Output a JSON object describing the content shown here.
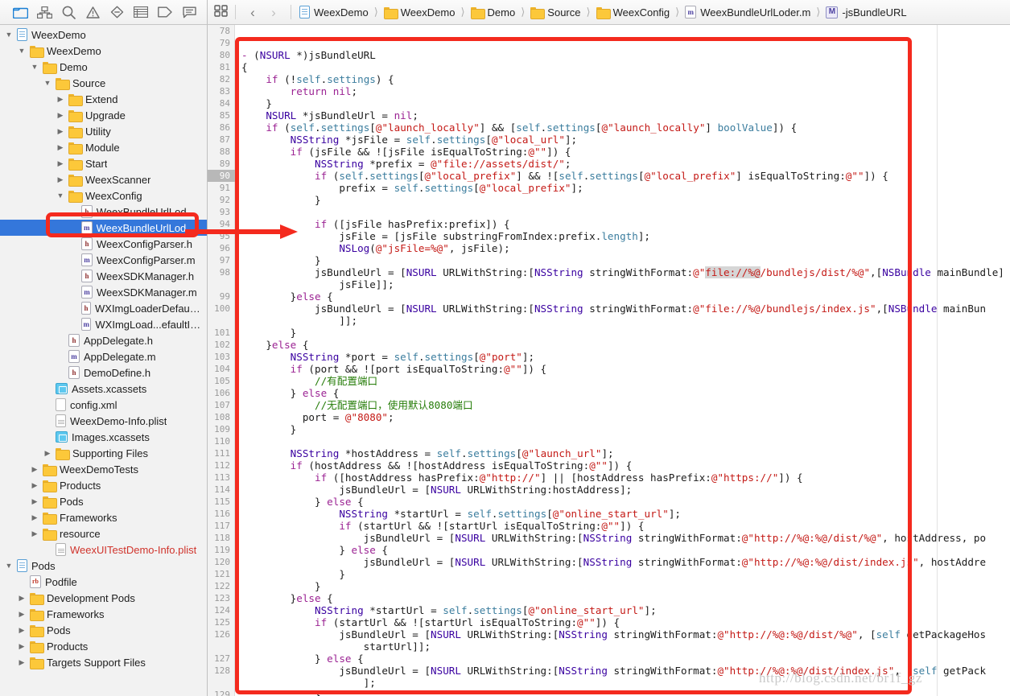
{
  "navigator_toolbar": {
    "icons": [
      {
        "name": "project-navigator-icon",
        "label": "Project navigator",
        "active": true
      },
      {
        "name": "source-control-navigator-icon",
        "label": "Source control navigator",
        "active": false
      },
      {
        "name": "find-navigator-icon",
        "label": "Find navigator",
        "active": false
      },
      {
        "name": "issue-navigator-icon",
        "label": "Issue navigator",
        "active": false
      },
      {
        "name": "test-navigator-icon",
        "label": "Test navigator",
        "active": false
      },
      {
        "name": "debug-navigator-icon",
        "label": "Debug navigator",
        "active": false
      },
      {
        "name": "breakpoint-navigator-icon",
        "label": "Breakpoint navigator",
        "active": false
      },
      {
        "name": "report-navigator-icon",
        "label": "Report navigator",
        "active": false
      }
    ]
  },
  "jump_bar": {
    "related_items_label": "Related items",
    "back_label": "‹",
    "forward_label": "›",
    "separator": "›",
    "breadcrumbs": [
      {
        "label": "WeexDemo",
        "icon": "project-icon"
      },
      {
        "label": "WeexDemo",
        "icon": "folder-icon"
      },
      {
        "label": "Demo",
        "icon": "folder-icon"
      },
      {
        "label": "Source",
        "icon": "folder-icon"
      },
      {
        "label": "WeexConfig",
        "icon": "folder-icon"
      },
      {
        "label": "WeexBundleUrlLoder.m",
        "icon": "objc-m-icon"
      },
      {
        "label": "-jsBundleURL",
        "icon": "method-symbol-icon"
      }
    ]
  },
  "navigator_tree": [
    {
      "label": "WeexDemo",
      "depth": 0,
      "twist": "open",
      "icon": "project-icon"
    },
    {
      "label": "WeexDemo",
      "depth": 1,
      "twist": "open",
      "icon": "folder-icon"
    },
    {
      "label": "Demo",
      "depth": 2,
      "twist": "open",
      "icon": "folder-icon"
    },
    {
      "label": "Source",
      "depth": 3,
      "twist": "open",
      "icon": "folder-icon"
    },
    {
      "label": "Extend",
      "depth": 4,
      "twist": "closed",
      "icon": "folder-icon"
    },
    {
      "label": "Upgrade",
      "depth": 4,
      "twist": "closed",
      "icon": "folder-icon"
    },
    {
      "label": "Utility",
      "depth": 4,
      "twist": "closed",
      "icon": "folder-icon"
    },
    {
      "label": "Module",
      "depth": 4,
      "twist": "closed",
      "icon": "folder-icon"
    },
    {
      "label": "Start",
      "depth": 4,
      "twist": "closed",
      "icon": "folder-icon"
    },
    {
      "label": "WeexScanner",
      "depth": 4,
      "twist": "closed",
      "icon": "folder-icon"
    },
    {
      "label": "WeexConfig",
      "depth": 4,
      "twist": "open",
      "icon": "folder-icon"
    },
    {
      "label": "WeexBundleUrlLoder.h",
      "depth": 5,
      "twist": "none",
      "icon": "objc-h-icon"
    },
    {
      "label": "WeexBundleUrlLoder.m",
      "depth": 5,
      "twist": "none",
      "icon": "objc-m-icon",
      "selected": true
    },
    {
      "label": "WeexConfigParser.h",
      "depth": 5,
      "twist": "none",
      "icon": "objc-h-icon"
    },
    {
      "label": "WeexConfigParser.m",
      "depth": 5,
      "twist": "none",
      "icon": "objc-m-icon"
    },
    {
      "label": "WeexSDKManager.h",
      "depth": 5,
      "twist": "none",
      "icon": "objc-h-icon"
    },
    {
      "label": "WeexSDKManager.m",
      "depth": 5,
      "twist": "none",
      "icon": "objc-m-icon"
    },
    {
      "label": "WXImgLoaderDefaultImpl.h",
      "depth": 5,
      "twist": "none",
      "icon": "objc-h-icon"
    },
    {
      "label": "WXImgLoad...efaultImpl.m",
      "depth": 5,
      "twist": "none",
      "icon": "objc-m-icon"
    },
    {
      "label": "AppDelegate.h",
      "depth": 4,
      "twist": "none",
      "icon": "objc-h-icon"
    },
    {
      "label": "AppDelegate.m",
      "depth": 4,
      "twist": "none",
      "icon": "objc-m-icon"
    },
    {
      "label": "DemoDefine.h",
      "depth": 4,
      "twist": "none",
      "icon": "objc-h-icon"
    },
    {
      "label": "Assets.xcassets",
      "depth": 3,
      "twist": "none",
      "icon": "xcassets-icon"
    },
    {
      "label": "config.xml",
      "depth": 3,
      "twist": "none",
      "icon": "plain-file-icon"
    },
    {
      "label": "WeexDemo-Info.plist",
      "depth": 3,
      "twist": "none",
      "icon": "plist-icon"
    },
    {
      "label": "Images.xcassets",
      "depth": 3,
      "twist": "none",
      "icon": "xcassets-icon"
    },
    {
      "label": "Supporting Files",
      "depth": 3,
      "twist": "closed",
      "icon": "folder-icon"
    },
    {
      "label": "WeexDemoTests",
      "depth": 2,
      "twist": "closed",
      "icon": "folder-icon"
    },
    {
      "label": "Products",
      "depth": 2,
      "twist": "closed",
      "icon": "folder-icon"
    },
    {
      "label": "Pods",
      "depth": 2,
      "twist": "closed",
      "icon": "folder-icon"
    },
    {
      "label": "Frameworks",
      "depth": 2,
      "twist": "closed",
      "icon": "folder-icon"
    },
    {
      "label": "resource",
      "depth": 2,
      "twist": "closed",
      "icon": "folder-icon"
    },
    {
      "label": "WeexUITestDemo-Info.plist",
      "depth": 3,
      "twist": "none",
      "icon": "plist-icon",
      "red": true
    },
    {
      "label": "Pods",
      "depth": 0,
      "twist": "open",
      "icon": "project-icon"
    },
    {
      "label": "Podfile",
      "depth": 1,
      "twist": "none",
      "icon": "ruby-icon"
    },
    {
      "label": "Development Pods",
      "depth": 1,
      "twist": "closed",
      "icon": "folder-icon"
    },
    {
      "label": "Frameworks",
      "depth": 1,
      "twist": "closed",
      "icon": "folder-icon"
    },
    {
      "label": "Pods",
      "depth": 1,
      "twist": "closed",
      "icon": "folder-icon"
    },
    {
      "label": "Products",
      "depth": 1,
      "twist": "closed",
      "icon": "folder-icon"
    },
    {
      "label": "Targets Support Files",
      "depth": 1,
      "twist": "closed",
      "icon": "folder-icon"
    }
  ],
  "editor": {
    "current_line": 90,
    "first_visible_line": 78,
    "lines": [
      {
        "n": 78,
        "html": ""
      },
      {
        "n": 79,
        "html": ""
      },
      {
        "n": 80,
        "html": "<span class=\"k\">-</span> (<span class=\"typ\">NSURL</span> *)jsBundleURL"
      },
      {
        "n": 81,
        "html": "{"
      },
      {
        "n": 82,
        "html": "    <span class=\"k\">if</span> (!<span class=\"prop\">self</span>.<span class=\"prop\">settings</span>) {"
      },
      {
        "n": 83,
        "html": "        <span class=\"k\">return</span> <span class=\"k\">nil</span>;"
      },
      {
        "n": 84,
        "html": "    }"
      },
      {
        "n": 85,
        "html": "    <span class=\"typ\">NSURL</span> *jsBundleUrl = <span class=\"k\">nil</span>;"
      },
      {
        "n": 86,
        "html": "    <span class=\"k\">if</span> (<span class=\"prop\">self</span>.<span class=\"prop\">settings</span>[<span class=\"str\">@\"launch_locally\"</span>] &amp;&amp; [<span class=\"prop\">self</span>.<span class=\"prop\">settings</span>[<span class=\"str\">@\"launch_locally\"</span>] <span class=\"prop\">boolValue</span>]) {"
      },
      {
        "n": 87,
        "html": "        <span class=\"typ\">NSString</span> *jsFile = <span class=\"prop\">self</span>.<span class=\"prop\">settings</span>[<span class=\"str\">@\"local_url\"</span>];"
      },
      {
        "n": 88,
        "html": "        <span class=\"k\">if</span> (jsFile &amp;&amp; ![jsFile isEqualToString:<span class=\"str\">@\"\"</span>]) {"
      },
      {
        "n": 89,
        "html": "            <span class=\"typ\">NSString</span> *prefix = <span class=\"str\">@\"file://assets/dist/\"</span>;"
      },
      {
        "n": 90,
        "html": "            <span class=\"k\">if</span> (<span class=\"prop\">self</span>.<span class=\"prop\">settings</span>[<span class=\"str\">@\"local_prefix\"</span>] &amp;&amp; ![<span class=\"prop\">self</span>.<span class=\"prop\">settings</span>[<span class=\"str\">@\"local_prefix\"</span>] isEqualToString:<span class=\"str\">@\"\"</span>]) {"
      },
      {
        "n": 91,
        "html": "                prefix = <span class=\"prop\">self</span>.<span class=\"prop\">settings</span>[<span class=\"str\">@\"local_prefix\"</span>];"
      },
      {
        "n": 92,
        "html": "            }"
      },
      {
        "n": 93,
        "html": ""
      },
      {
        "n": 94,
        "html": "            <span class=\"k\">if</span> ([jsFile hasPrefix:prefix]) {"
      },
      {
        "n": 95,
        "html": "                jsFile = [jsFile substringFromIndex:prefix.<span class=\"prop\">length</span>];"
      },
      {
        "n": 96,
        "html": "                <span class=\"typ\">NSLog</span>(<span class=\"str\">@\"jsFile=%@\"</span>, jsFile);"
      },
      {
        "n": 97,
        "html": "            }"
      },
      {
        "n": 98,
        "html": "            jsBundleUrl = [<span class=\"typ\">NSURL</span> URLWithString:[<span class=\"typ\">NSString</span> stringWithFormat:<span class=\"str\">@\"<span class=\"sel-hl\">file://%@</span>/bundlejs/dist/%@\"</span>,[<span class=\"typ\">NSBundle</span> mainBundle]"
      },
      {
        "n": 0,
        "html": "                jsFile]];"
      },
      {
        "n": 99,
        "html": "        }<span class=\"k\">else</span> {"
      },
      {
        "n": 100,
        "html": "            jsBundleUrl = [<span class=\"typ\">NSURL</span> URLWithString:[<span class=\"typ\">NSString</span> stringWithFormat:<span class=\"str\">@\"file://%@/bundlejs/index.js\"</span>,[<span class=\"typ\">NSBundle</span> mainBun"
      },
      {
        "n": 0,
        "html": "                ]];"
      },
      {
        "n": 101,
        "html": "        }"
      },
      {
        "n": 102,
        "html": "    }<span class=\"k\">else</span> {"
      },
      {
        "n": 103,
        "html": "        <span class=\"typ\">NSString</span> *port = <span class=\"prop\">self</span>.<span class=\"prop\">settings</span>[<span class=\"str\">@\"port\"</span>];"
      },
      {
        "n": 104,
        "html": "        <span class=\"k\">if</span> (port &amp;&amp; ![port isEqualToString:<span class=\"str\">@\"\"</span>]) {"
      },
      {
        "n": 105,
        "html": "            <span class=\"cmt\">//有配置端口</span>"
      },
      {
        "n": 106,
        "html": "        } <span class=\"k\">else</span> {"
      },
      {
        "n": 107,
        "html": "            <span class=\"cmt\">//无配置端口，使用默认8080端口</span>"
      },
      {
        "n": 108,
        "html": "          port = <span class=\"str\">@\"8080\"</span>;"
      },
      {
        "n": 109,
        "html": "        }"
      },
      {
        "n": 110,
        "html": ""
      },
      {
        "n": 111,
        "html": "        <span class=\"typ\">NSString</span> *hostAddress = <span class=\"prop\">self</span>.<span class=\"prop\">settings</span>[<span class=\"str\">@\"launch_url\"</span>];"
      },
      {
        "n": 112,
        "html": "        <span class=\"k\">if</span> (hostAddress &amp;&amp; ![hostAddress isEqualToString:<span class=\"str\">@\"\"</span>]) {"
      },
      {
        "n": 113,
        "html": "            <span class=\"k\">if</span> ([hostAddress hasPrefix:<span class=\"str\">@\"http://\"</span>] || [hostAddress hasPrefix:<span class=\"str\">@\"https://\"</span>]) {"
      },
      {
        "n": 114,
        "html": "                jsBundleUrl = [<span class=\"typ\">NSURL</span> URLWithString:hostAddress];"
      },
      {
        "n": 115,
        "html": "            } <span class=\"k\">else</span> {"
      },
      {
        "n": 116,
        "html": "                <span class=\"typ\">NSString</span> *startUrl = <span class=\"prop\">self</span>.<span class=\"prop\">settings</span>[<span class=\"str\">@\"online_start_url\"</span>];"
      },
      {
        "n": 117,
        "html": "                <span class=\"k\">if</span> (startUrl &amp;&amp; ![startUrl isEqualToString:<span class=\"str\">@\"\"</span>]) {"
      },
      {
        "n": 118,
        "html": "                    jsBundleUrl = [<span class=\"typ\">NSURL</span> URLWithString:[<span class=\"typ\">NSString</span> stringWithFormat:<span class=\"str\">@\"http://%@:%@/dist/%@\"</span>, hostAddress, po"
      },
      {
        "n": 119,
        "html": "                } <span class=\"k\">else</span> {"
      },
      {
        "n": 120,
        "html": "                    jsBundleUrl = [<span class=\"typ\">NSURL</span> URLWithString:[<span class=\"typ\">NSString</span> stringWithFormat:<span class=\"str\">@\"http://%@:%@/dist/index.js\"</span>, hostAddre"
      },
      {
        "n": 121,
        "html": "                }"
      },
      {
        "n": 122,
        "html": "            }"
      },
      {
        "n": 123,
        "html": "        }<span class=\"k\">else</span> {"
      },
      {
        "n": 124,
        "html": "            <span class=\"typ\">NSString</span> *startUrl = <span class=\"prop\">self</span>.<span class=\"prop\">settings</span>[<span class=\"str\">@\"online_start_url\"</span>];"
      },
      {
        "n": 125,
        "html": "            <span class=\"k\">if</span> (startUrl &amp;&amp; ![startUrl isEqualToString:<span class=\"str\">@\"\"</span>]) {"
      },
      {
        "n": 126,
        "html": "                jsBundleUrl = [<span class=\"typ\">NSURL</span> URLWithString:[<span class=\"typ\">NSString</span> stringWithFormat:<span class=\"str\">@\"http://%@:%@/dist/%@\"</span>, [<span class=\"prop\">self</span> getPackageHos"
      },
      {
        "n": 0,
        "html": "                    startUrl]];"
      },
      {
        "n": 127,
        "html": "            } <span class=\"k\">else</span> {"
      },
      {
        "n": 128,
        "html": "                jsBundleUrl = [<span class=\"typ\">NSURL</span> URLWithString:[<span class=\"typ\">NSString</span> stringWithFormat:<span class=\"str\">@\"http://%@:%@/dist/index.js\"</span>, [<span class=\"prop\">self</span> getPack"
      },
      {
        "n": 0,
        "html": "                    ];"
      },
      {
        "n": 129,
        "html": "            }"
      }
    ]
  },
  "annotations": {
    "watermark": "http://blog.csdn.net/br1f_gz",
    "highlight_color": "#f42a1e"
  }
}
